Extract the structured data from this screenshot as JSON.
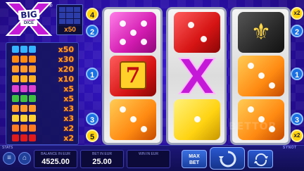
{
  "logo": {
    "big": "BIG",
    "dice": "DICE",
    "reg": "®"
  },
  "jackpot": {
    "multiplier": "x50"
  },
  "paytable": [
    {
      "color": "#34b3ff",
      "mult": "x50"
    },
    {
      "color": "#ff8a12",
      "mult": "x30"
    },
    {
      "color": "#ff9a2a",
      "mult": "x20"
    },
    {
      "color": "#ffb020",
      "mult": "x10"
    },
    {
      "color": "#e040d0",
      "mult": "x5"
    },
    {
      "color": "#40c040",
      "mult": "x5"
    },
    {
      "color": "#ff9a2a",
      "mult": "x3"
    },
    {
      "color": "#ffd030",
      "mult": "x3"
    },
    {
      "color": "#ff7a20",
      "mult": "x2"
    },
    {
      "color": "#e01a1a",
      "mult": "x2"
    }
  ],
  "paylines": {
    "left": [
      "4",
      "2",
      "1",
      "3",
      "5"
    ],
    "right": [
      "x2",
      "2",
      "1",
      "3",
      "x2"
    ]
  },
  "reels": [
    [
      "pink die",
      "seven",
      "orange die"
    ],
    [
      "red die",
      "big X",
      "yellow die"
    ],
    [
      "fleur-de-lis",
      "orange die",
      "orange die"
    ]
  ],
  "bottom": {
    "stats_label": "STATS",
    "balance_label": "BALANCE IN EUR",
    "balance_value": "4525.00",
    "bet_label": "BET IN EUR",
    "bet_value": "25.00",
    "win_label": "WIN IN EUR",
    "win_value": "",
    "maxbet_line1": "MAX",
    "maxbet_line2": "BET",
    "brand": "SYNOT"
  },
  "watermark": "BETTOR",
  "colors": {
    "accent": "#ff9a2a",
    "background": "#2a0fa8",
    "line_blue": "#1b6fe0",
    "line_yellow": "#ffd310"
  }
}
